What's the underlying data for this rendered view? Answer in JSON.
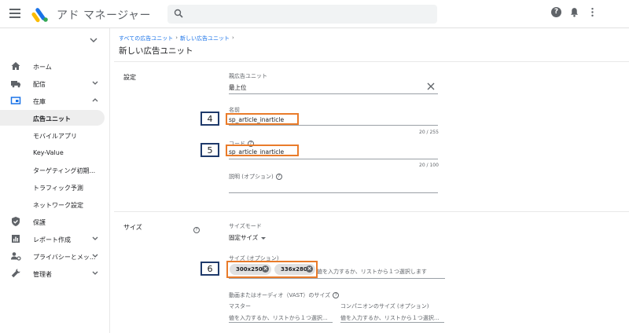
{
  "header": {
    "app_title": "アド マネージャー",
    "search_placeholder": ""
  },
  "sidebar": {
    "items": [
      {
        "label": "ホーム"
      },
      {
        "label": "配信"
      },
      {
        "label": "在庫"
      },
      {
        "label": "広告ユニット"
      },
      {
        "label": "モバイルアプリ"
      },
      {
        "label": "Key-Value"
      },
      {
        "label": "ターゲティング初期..."
      },
      {
        "label": "トラフィック予測"
      },
      {
        "label": "ネットワーク設定"
      },
      {
        "label": "保護"
      },
      {
        "label": "レポート作成"
      },
      {
        "label": "プライバシーとメッ..."
      },
      {
        "label": "管理者"
      }
    ]
  },
  "breadcrumb": {
    "items": [
      "すべての広告ユニット",
      "新しい広告ユニット"
    ],
    "separator": "›"
  },
  "page": {
    "title": "新しい広告ユニット"
  },
  "settings": {
    "heading": "設定",
    "parent": {
      "label": "親広告ユニット",
      "value": "最上位"
    },
    "name": {
      "label": "名前",
      "value": "sp_article_inarticle",
      "counter": "20 / 255"
    },
    "code": {
      "label": "コード",
      "value": "sp_article_inarticle",
      "counter": "20 / 100"
    },
    "description": {
      "label": "説明 (オプション)"
    }
  },
  "size": {
    "heading": "サイズ",
    "mode_label": "サイズモード",
    "mode_value": "固定サイズ",
    "sizes_label": "サイズ (オプション)",
    "chips": [
      "300x250",
      "336x280"
    ],
    "sizes_placeholder": "値を入力するか、リストから１つ選択します",
    "video_label": "動画またはオーディオ（VAST）のサイズ",
    "master_label": "マスター",
    "master_placeholder": "値を入力するか、リストから１つ選択...",
    "companion_label": "コンパニオンのサイズ (オプション)",
    "companion_placeholder": "値を入力するか、リストから１つ選択..."
  },
  "annotations": {
    "n4": "4",
    "n5": "5",
    "n6": "6"
  },
  "colors": {
    "accent": "#1a73e8",
    "highlight": "#e97b2a",
    "label_box": "#1f3a6b"
  }
}
